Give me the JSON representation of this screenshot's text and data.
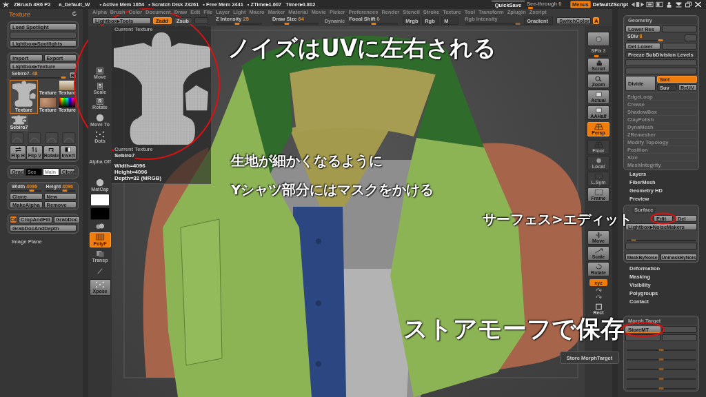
{
  "title_bar": {
    "app": "ZBrush 4R6 P2",
    "document": "a_Default_W",
    "stats": [
      "• Active Mem 1654",
      "• Scratch Disk 23261",
      "• Free Mem 2441",
      "• ZTime▸1.607",
      "Timer▸0.802"
    ],
    "quicksave": "QuickSave",
    "see_through": {
      "label": "See-through",
      "value": "0",
      "level": 0
    },
    "menus": {
      "label": "Menus",
      "on": true
    },
    "script": "DefaultZScript"
  },
  "menu_bar": [
    "Alpha",
    "Brush",
    "Color",
    "Document",
    "Draw",
    "Edit",
    "File",
    "Layer",
    "Light",
    "Macro",
    "Marker",
    "Material",
    "Movie",
    "Picker",
    "Preferences",
    "Render",
    "Stencil",
    "Stroke",
    "Texture",
    "Tool",
    "Transform",
    "Zplugin",
    "Zscript"
  ],
  "toolbar": {
    "lightbox": "Lightbox▸Tools",
    "modes": [
      {
        "label": "Zadd",
        "on": true,
        "disabled": false
      },
      {
        "label": "Zsub",
        "on": false,
        "disabled": false
      },
      {
        "on": false,
        "disabled": true
      }
    ],
    "sliders": [
      {
        "label": "Z Intensity",
        "value": "25",
        "level": 0.45
      },
      {
        "label": "Draw Size",
        "value": "64",
        "level": 0.3
      }
    ],
    "dynamic": "Dynamic",
    "focal_shift": {
      "label": "Focal Shift",
      "value": "0",
      "level": 0.5
    },
    "channels": [
      "Mrgb",
      "Rgb",
      "M"
    ],
    "rgb_intensity": {
      "label": "Rgb Intensity",
      "level": 1,
      "disabled": true
    },
    "gradient": "Gradient",
    "switch_color": "SwitchColor",
    "alternate": {
      "label": "A",
      "on": true
    }
  },
  "left_tray": {
    "title": "Texture",
    "spotlight": [
      {
        "label": "Load Spotlight",
        "disabled": false
      },
      {
        "disabled": true
      },
      {
        "label": "Lightbox▸Spotlights",
        "disabled": false
      }
    ],
    "import": "Import",
    "export": "Export",
    "lightbox": "Lightbox▸Texture",
    "texture_slider": {
      "label": "Sebiro7.",
      "value": "48",
      "level": 0.95
    },
    "r_button": "R",
    "thumbnails": [
      {
        "label": "Texture",
        "kind": "uv",
        "selected": true
      },
      {
        "label": "Texture",
        "kind": "empty",
        "selected": false
      },
      {
        "label": "Texture",
        "kind": "photo",
        "selected": false
      },
      {
        "label": "Texture",
        "kind": "noise",
        "selected": false
      },
      {
        "label": "Texture",
        "kind": "spectrum",
        "selected": false
      },
      {
        "label": "Sebiro7",
        "kind": "uv",
        "selected": false
      }
    ],
    "tools": [
      {
        "label": "Flip H",
        "kind": "fliph"
      },
      {
        "label": "Flip V",
        "kind": "flipv"
      },
      {
        "label": "Rotate",
        "kind": "rotate"
      },
      {
        "label": "Invert",
        "kind": "invert"
      }
    ],
    "grad": "Grad",
    "swatches": [
      {
        "label": "Sec",
        "color": "#000000"
      },
      {
        "label": "Main",
        "color": "#ffffff"
      }
    ],
    "clear": "Clear",
    "size_sliders": [
      {
        "label": "Width",
        "value": "4096",
        "level": 0.7
      },
      {
        "label": "Height",
        "value": "4096",
        "level": 0.65
      }
    ],
    "actions": [
      "Clone",
      "New",
      "MakeAlpha",
      "Remove"
    ],
    "cd": {
      "label": "Cd",
      "on": true
    },
    "crop": "CropAndFill",
    "grabdoc": "GrabDoc",
    "grabdoc_depth": "GrabDocAndDepth",
    "image_plane": "Image Plane"
  },
  "left_shelf": [
    {
      "kind": "letter",
      "key": "M",
      "label": "Move",
      "on": false
    },
    {
      "kind": "letter",
      "key": "S",
      "label": "Scale",
      "on": false
    },
    {
      "kind": "letter",
      "key": "R",
      "label": "Rotate",
      "on": false
    },
    {
      "kind": "sphere",
      "label": "Move To",
      "on": false
    },
    {
      "kind": "dots",
      "label": "Dots",
      "on": false
    },
    {
      "kind": "alpha",
      "label": "Alpha Off",
      "on": false
    },
    {
      "kind": "matcap",
      "label": "MatCap",
      "on": false
    },
    {
      "kind": "swatch",
      "color": "#ffffff",
      "on": false
    },
    {
      "kind": "swatch",
      "color": "#000000",
      "on": false
    },
    {
      "kind": "blobs",
      "on": false
    },
    {
      "kind": "polyf",
      "label": "PolyF",
      "on": true
    },
    {
      "kind": "transp",
      "label": "Transp",
      "on": false
    },
    {
      "kind": "blank",
      "on": false
    },
    {
      "kind": "xpose",
      "label": "Xpose",
      "on": false
    }
  ],
  "texture_popup": {
    "title": "Current Texture",
    "caption": "Current Texture",
    "name": "Sebiro7",
    "details": [
      "Width=4096",
      "Height=4096",
      "Depth=32 (MRGB)"
    ]
  },
  "annotations": [
    "ノイズはUVに左右される",
    "生地が細かくなるように",
    "Yシャツ部分にはマスクをかける",
    "サーフェス>エディット",
    "ストアモーフで保存"
  ],
  "store_morph_button": "Store MorphTarget",
  "right_shelf": [
    {
      "kind": "bpr",
      "on": false
    },
    {
      "kind": "spix",
      "label": "SPix",
      "value": "3",
      "level": 0.4
    },
    {
      "kind": "scroll",
      "label": "Scroll",
      "on": false
    },
    {
      "kind": "zoom",
      "label": "Zoom",
      "on": false
    },
    {
      "kind": "actual",
      "label": "Actual",
      "on": false
    },
    {
      "kind": "aahalf",
      "label": "AAHalf",
      "on": false
    },
    {
      "kind": "persp",
      "label": "Persp",
      "on": true
    },
    {
      "kind": "floor",
      "label": "Floor",
      "on": false
    },
    {
      "kind": "local",
      "label": "Local",
      "on": false
    },
    {
      "kind": "lsym",
      "label": "L.Sym",
      "on": false
    },
    {
      "kind": "frame",
      "label": "Frame",
      "on": false
    },
    {
      "kind": "move",
      "label": "Move",
      "on": false
    },
    {
      "kind": "scale",
      "label": "Scale",
      "on": false
    },
    {
      "kind": "rotate",
      "label": "Rotate",
      "on": false
    },
    {
      "kind": "xyz",
      "label": "xyz",
      "on": true
    },
    {
      "kind": "mini",
      "on": false
    },
    {
      "kind": "mini",
      "on": false
    },
    {
      "kind": "rect",
      "label": "Rect",
      "on": false
    }
  ],
  "right_tray": {
    "geometry": {
      "title": "Geometry",
      "lower_res": "Lower Res",
      "sdiv": {
        "label": "SDiv",
        "value": "8",
        "level": 1
      },
      "del_lower": "Del Lower",
      "freeze": "Freeze SubDivision Levels",
      "divide": "Divide",
      "smooth_modes": [
        {
          "label": "Smt",
          "on": true
        },
        {
          "label": "Suv",
          "on": false
        }
      ],
      "reuv": "ReUV",
      "subpalettes": [
        "EdgeLoop",
        "Crease",
        "ShadowBox",
        "ClayPolish",
        "DynaMesh",
        "ZRemesher",
        "Modify Topology",
        "Position",
        "Size",
        "MeshIntegrity"
      ]
    },
    "palettes": [
      "Layers",
      "FiberMesh",
      "Geometry HD",
      "Preview"
    ],
    "surface": {
      "title": "Surface",
      "edit": "Edit",
      "del": "Del",
      "lightbox": "Lightbox▸NoiseMakers",
      "strength": {
        "level": 0.1
      },
      "mask": "MaskByNoise",
      "unmask": "UnmaskByNois"
    },
    "palettes_2": [
      "Deformation",
      "Masking",
      "Visibility",
      "Polygroups",
      "Contact"
    ],
    "morph": {
      "title": "Morph Target",
      "store": {
        "label": "StoreMT",
        "focused": true
      },
      "sliders": [
        {
          "level": 0.5
        },
        {
          "level": 0.5
        },
        {
          "level": 0.5
        },
        {
          "level": 0.5
        },
        {
          "level": 0.5
        }
      ]
    }
  }
}
